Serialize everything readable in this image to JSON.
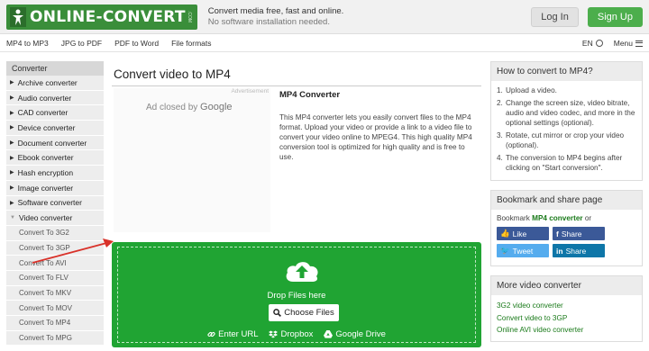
{
  "header": {
    "logo_text": "ONLINE-CONVERT",
    "logo_suffix": ".COM",
    "tagline_1": "Convert media free, fast and online.",
    "tagline_2": "No software installation needed.",
    "login_label": "Log In",
    "signup_label": "Sign Up"
  },
  "nav": {
    "links": [
      "MP4 to MP3",
      "JPG to PDF",
      "PDF to Word",
      "File formats"
    ],
    "language": "EN",
    "menu_label": "Menu"
  },
  "sidebar": {
    "heading": "Converter",
    "items": [
      "Archive converter",
      "Audio converter",
      "CAD converter",
      "Device converter",
      "Document converter",
      "Ebook converter",
      "Hash encryption",
      "Image converter",
      "Software converter",
      "Video converter"
    ],
    "sub_items": [
      "Convert To 3G2",
      "Convert To 3GP",
      "Convert To AVI",
      "Convert To FLV",
      "Convert To MKV",
      "Convert To MOV",
      "Convert To MP4",
      "Convert To MPG"
    ]
  },
  "main": {
    "title": "Convert video to MP4",
    "ad_label": "Advertisement",
    "ad_closed_prefix": "Ad closed by",
    "ad_closed_brand": "Google",
    "desc_title": "MP4 Converter",
    "desc_text": "This MP4 converter lets you easily convert files to the MP4 format. Upload your video or provide a link to a video file to convert your video online to MPEG4. This high quality MP4 conversion tool is optimized for high quality and is free to use."
  },
  "upload": {
    "drop_text": "Drop Files here",
    "choose_label": "Choose Files",
    "enter_url": "Enter URL",
    "dropbox": "Dropbox",
    "google_drive": "Google Drive",
    "bg_color": "#20a433"
  },
  "how_to": {
    "heading": "How to convert to MP4?",
    "steps": [
      "Upload a video.",
      "Change the screen size, video bitrate, audio and video codec, and more in the optional settings (optional).",
      "Rotate, cut mirror or crop your video (optional).",
      "The conversion to MP4 begins after clicking on \"Start conversion\"."
    ]
  },
  "bookmark": {
    "heading": "Bookmark and share page",
    "line_prefix": "Bookmark",
    "line_link": "MP4 converter",
    "line_suffix": "or",
    "like": "Like",
    "share": "Share",
    "tweet": "Tweet",
    "share_in": "Share"
  },
  "more": {
    "heading": "More video converter",
    "links": [
      "3G2 video converter",
      "Convert video to 3GP",
      "Online AVI video converter"
    ]
  }
}
